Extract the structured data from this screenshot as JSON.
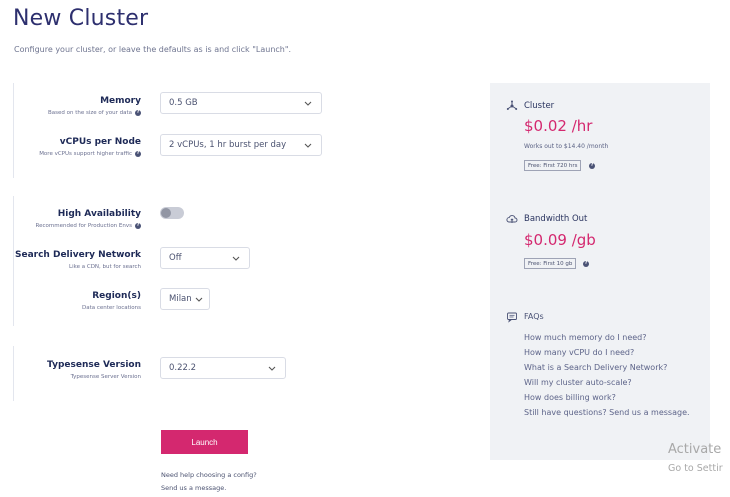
{
  "header": {
    "title": "New Cluster",
    "subtitle": "Configure your cluster, or leave the defaults as is and click \"Launch\"."
  },
  "form": {
    "memory": {
      "label": "Memory",
      "hint": "Based on the size of your data",
      "value": "0.5 GB"
    },
    "vcpus": {
      "label": "vCPUs per Node",
      "hint": "More vCPUs support higher traffic",
      "value": "2 vCPUs, 1 hr burst per day"
    },
    "ha": {
      "label": "High Availability",
      "hint": "Recommended for Production Envs",
      "enabled": false
    },
    "sdn": {
      "label": "Search Delivery Network",
      "hint": "Like a CDN, but for search",
      "value": "Off"
    },
    "region": {
      "label": "Region(s)",
      "hint": "Data center locations",
      "value": "Milan"
    },
    "version": {
      "label": "Typesense Version",
      "hint": "Typesense Server Version",
      "value": "0.22.2"
    }
  },
  "launch_label": "Launch",
  "help": {
    "line1": "Need help choosing a config?",
    "line2": "Send us a message."
  },
  "summary": {
    "cluster": {
      "title": "Cluster",
      "price": "$0.02 /hr",
      "note": "Works out to $14.40 /month",
      "badge": "Free: First 720 hrs",
      "icon": "cluster-icon"
    },
    "bandwidth": {
      "title": "Bandwidth Out",
      "price": "$0.09 /gb",
      "badge": "Free: First 10 gb",
      "icon": "cloud-upload-icon"
    },
    "faqs": {
      "title": "FAQs",
      "items": [
        "How much memory do I need?",
        "How many vCPU do I need?",
        "What is a Search Delivery Network?",
        "Will my cluster auto-scale?",
        "How does billing work?",
        "Still have questions? Send us a message."
      ]
    }
  },
  "watermark": {
    "line1": "Activate",
    "line2": "Go to Settir"
  },
  "colors": {
    "accent": "#d4286f",
    "title": "#2d2f6e",
    "panel": "#f0f2f5"
  }
}
